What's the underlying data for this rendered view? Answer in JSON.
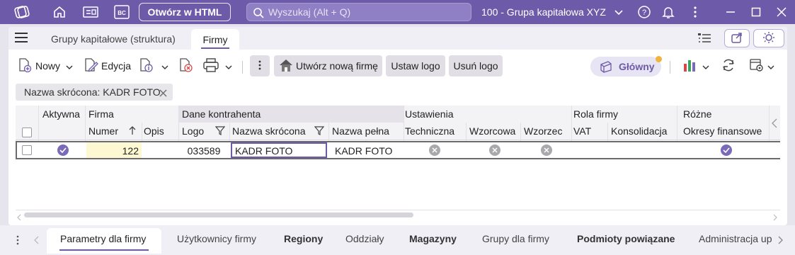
{
  "topbar": {
    "html_button": "Otwórz w HTML",
    "search_placeholder": "Wyszukaj (Alt + Q)",
    "company": "100 - Grupa kapitałowa XYZ"
  },
  "tabs": {
    "tab1": "Grupy kapitałowe (struktura)",
    "tab2": "Firmy"
  },
  "toolbar": {
    "new": "Nowy",
    "edit": "Edycja",
    "create_company": "Utwórz nową firmę",
    "set_logo": "Ustaw logo",
    "remove_logo": "Usuń logo",
    "main": "Główny"
  },
  "filter": {
    "chip": "Nazwa skrócona: KADR FOTO"
  },
  "grid": {
    "groups": {
      "aktywna": "Aktywna",
      "firma": "Firma",
      "dane": "Dane kontrahenta",
      "ustawienia": "Ustawienia",
      "rola": "Rola firmy",
      "rozne": "Różne"
    },
    "columns": {
      "numer": "Numer",
      "opis": "Opis",
      "logo": "Logo",
      "nazwa_skrocona": "Nazwa skrócona",
      "nazwa_pelna": "Nazwa pełna",
      "techniczna": "Techniczna",
      "wzorcowa": "Wzorcowa",
      "wzorzec": "Wzorzec",
      "vat": "VAT",
      "konsolidacja": "Konsolidacja",
      "okresy": "Okresy finansowe"
    },
    "row": {
      "numer": "122",
      "logo": "033589",
      "nazwa_skrocona": "KADR FOTO",
      "nazwa_pelna": "KADR FOTO"
    }
  },
  "bottom_tabs": [
    "Parametry dla firmy",
    "Użytkownicy firmy",
    "Regiony",
    "Oddziały",
    "Magazyny",
    "Grupy dla firmy",
    "Podmioty powiązane",
    "Administracja up"
  ]
}
